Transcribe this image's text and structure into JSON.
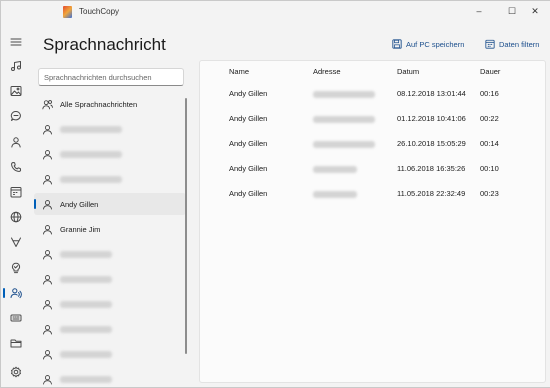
{
  "app": {
    "title": "TouchCopy"
  },
  "window_controls": {
    "minimize": "–",
    "maximize": "☐",
    "close": "✕"
  },
  "rail": [
    {
      "name": "menu-icon"
    },
    {
      "name": "music-icon"
    },
    {
      "name": "photos-icon"
    },
    {
      "name": "messages-icon"
    },
    {
      "name": "contacts-icon"
    },
    {
      "name": "calls-icon"
    },
    {
      "name": "calendar-icon"
    },
    {
      "name": "internet-icon"
    },
    {
      "name": "notes-icon"
    },
    {
      "name": "reminders-icon"
    },
    {
      "name": "voicemail-icon",
      "active": true
    },
    {
      "name": "wifi-icon"
    },
    {
      "name": "files-icon"
    },
    {
      "name": "settings-icon"
    }
  ],
  "page": {
    "title": "Sprachnachricht"
  },
  "toolbar": {
    "save_label": "Auf PC speichern",
    "filter_label": "Daten filtern"
  },
  "search": {
    "placeholder": "Sprachnachrichten durchsuchen"
  },
  "contacts": [
    {
      "label": "Alle Sprachnachrichten",
      "type": "group"
    },
    {
      "label": "",
      "blurred": true,
      "w": 62
    },
    {
      "label": "",
      "blurred": true,
      "w": 62
    },
    {
      "label": "",
      "blurred": true,
      "w": 62
    },
    {
      "label": "Andy Gillen",
      "selected": true
    },
    {
      "label": "Grannie Jim"
    },
    {
      "label": "",
      "blurred": true,
      "w": 52
    },
    {
      "label": "",
      "blurred": true,
      "w": 52
    },
    {
      "label": "",
      "blurred": true,
      "w": 52
    },
    {
      "label": "",
      "blurred": true,
      "w": 52
    },
    {
      "label": "",
      "blurred": true,
      "w": 52
    },
    {
      "label": "",
      "blurred": true,
      "w": 52
    }
  ],
  "table": {
    "headers": [
      "Name",
      "Adresse",
      "Datum",
      "Dauer"
    ],
    "rows": [
      {
        "name": "Andy Gillen",
        "datum": "08.12.2018 13:01:44",
        "dauer": "00:16"
      },
      {
        "name": "Andy Gillen",
        "datum": "01.12.2018 10:41:06",
        "dauer": "00:22"
      },
      {
        "name": "Andy Gillen",
        "datum": "26.10.2018 15:05:29",
        "dauer": "00:14"
      },
      {
        "name": "Andy Gillen",
        "datum": "11.06.2018 16:35:26",
        "dauer": "00:10"
      },
      {
        "name": "Andy Gillen",
        "datum": "11.05.2018 22:32:49",
        "dauer": "00:23"
      }
    ]
  }
}
